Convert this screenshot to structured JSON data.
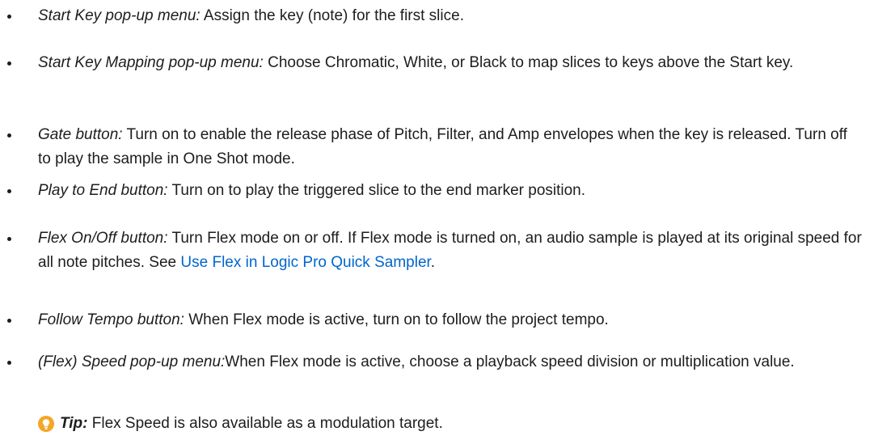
{
  "items": [
    {
      "term": "Start Key pop-up menu:",
      "text": " Assign the key (note) for the first slice."
    },
    {
      "term": "Start Key Mapping pop-up menu:",
      "text": " Choose Chromatic, White, or Black to map slices to keys above the Start key."
    },
    {
      "term": "Gate button:",
      "text": " Turn on to enable the release phase of Pitch, Filter, and Amp envelopes when the key is released. Turn off to play the sample in One Shot mode."
    },
    {
      "term": "Play to End button:",
      "text": " Turn on to play the triggered slice to the end marker position."
    },
    {
      "term": "Flex On/Off button:",
      "text": " Turn Flex mode on or off. If Flex mode is turned on, an audio sample is played at its original speed for all note pitches. See ",
      "link": "Use Flex in Logic Pro Quick Sampler",
      "after": "."
    },
    {
      "term": "Follow Tempo button:",
      "text": " When Flex mode is active, turn on to follow the project tempo."
    },
    {
      "term": "(Flex) Speed pop-up menu:",
      "text": "When Flex mode is active, choose a playback speed division or multiplication value."
    }
  ],
  "tip": {
    "label": "Tip:",
    "text": " Flex Speed is also available as a modulation target.",
    "icon": "lightbulb-icon",
    "icon_color": "#f5a623"
  },
  "colors": {
    "text": "#1d1d1f",
    "link": "#0066cc"
  }
}
